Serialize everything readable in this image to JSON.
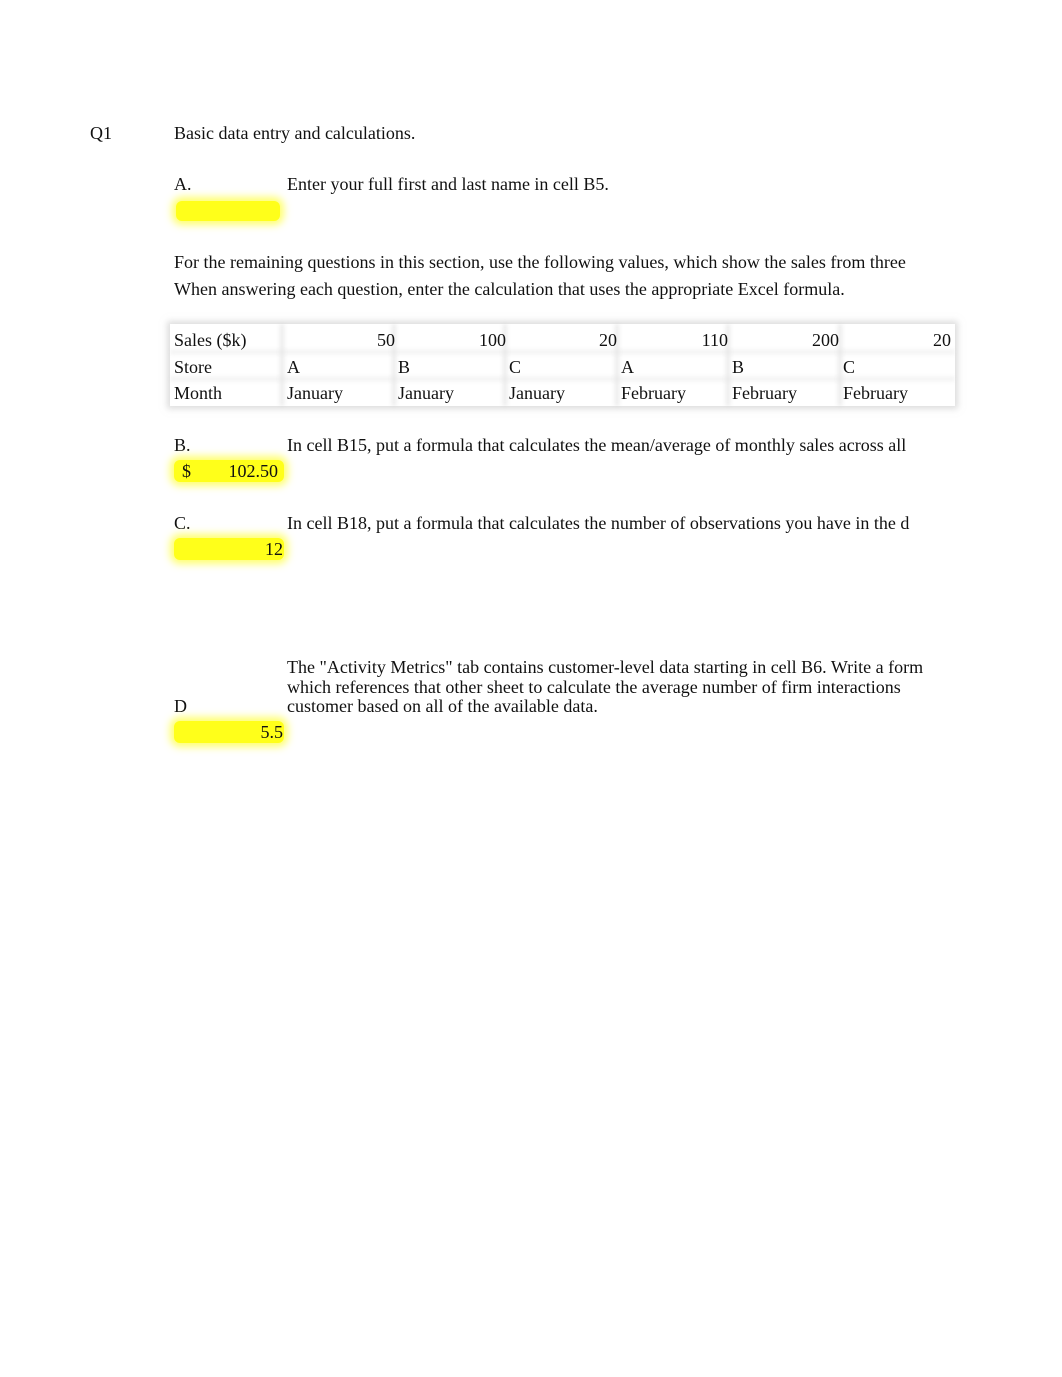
{
  "section": {
    "label": "Q1",
    "title": "Basic data entry and calculations."
  },
  "questions": {
    "a": {
      "label": "A.",
      "text": "Enter your full first and last name in cell B5.",
      "answer": ""
    },
    "intro": {
      "line1": "For the remaining questions in this section, use the following values, which show the sales from three",
      "line2": "When answering each question, enter the calculation that uses the appropriate Excel formula."
    },
    "b": {
      "label": "B.",
      "text": "In cell B15, put a formula that calculates the mean/average of monthly sales across all",
      "answer_currency": "$",
      "answer": "102.50"
    },
    "c": {
      "label": "C.",
      "text": "In cell B18, put a formula that calculates the number of observations you have in the d",
      "answer": "12"
    },
    "d": {
      "label": "D",
      "text_line1": "The \"Activity Metrics\" tab contains customer-level data starting in cell B6.  Write a form",
      "text_line2": "which references that other sheet to calculate the average number of firm interactions",
      "text_line3": "customer based on all of the available data.",
      "answer": "5.5"
    }
  },
  "sales_table": {
    "row_labels": [
      "Sales ($k)",
      "Store",
      "Month"
    ],
    "sales": [
      "50",
      "100",
      "20",
      "110",
      "200",
      "20"
    ],
    "stores": [
      "A",
      "B",
      "C",
      "A",
      "B",
      "C"
    ],
    "months": [
      "January",
      "January",
      "January",
      "February",
      "February",
      "February"
    ]
  },
  "colors": {
    "highlight": "#ffff1a",
    "table_border": "#d7d7d7"
  }
}
